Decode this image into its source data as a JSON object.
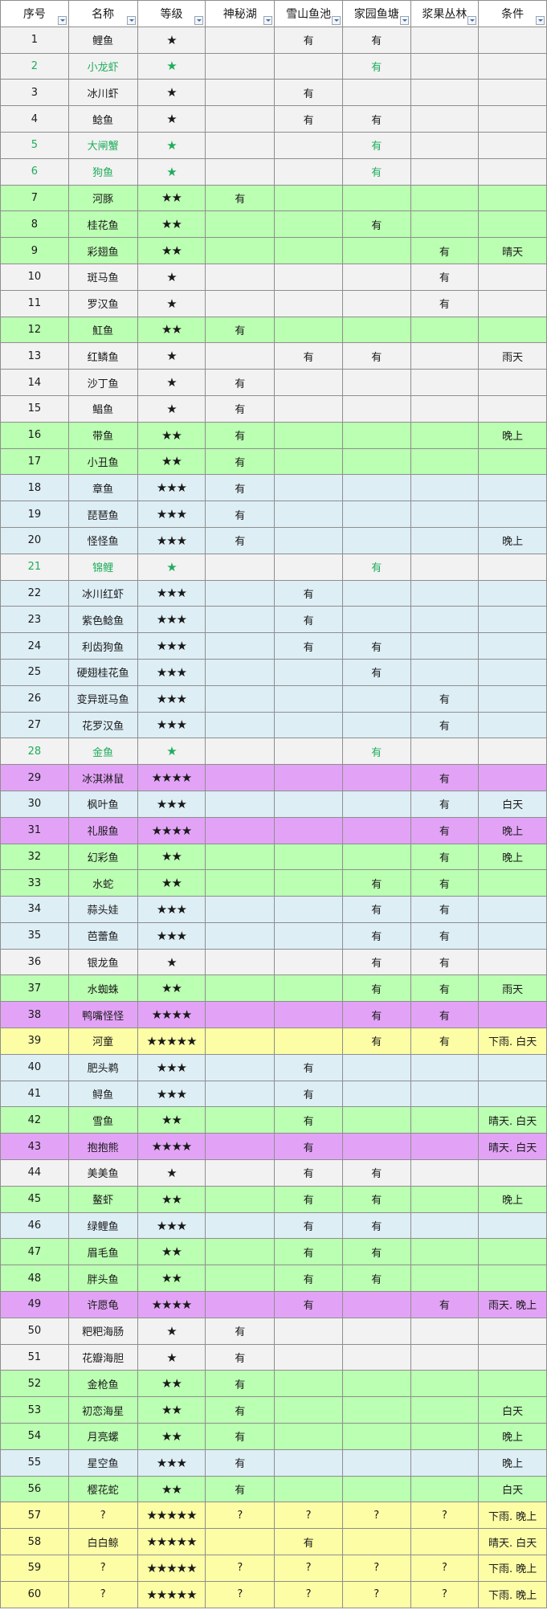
{
  "headers": [
    "序号",
    "名称",
    "等级",
    "神秘湖",
    "雪山鱼池",
    "家园鱼塘",
    "浆果丛林",
    "条件"
  ],
  "rows": [
    {
      "no": "1",
      "name": "鲤鱼",
      "grade": "★",
      "lake": "",
      "snow": "有",
      "home": "有",
      "berry": "",
      "cond": "",
      "color": "grey",
      "special": false
    },
    {
      "no": "2",
      "name": "小龙虾",
      "grade": "★",
      "lake": "",
      "snow": "",
      "home": "有",
      "berry": "",
      "cond": "",
      "color": "grey",
      "special": true
    },
    {
      "no": "3",
      "name": "冰川虾",
      "grade": "★",
      "lake": "",
      "snow": "有",
      "home": "",
      "berry": "",
      "cond": "",
      "color": "grey",
      "special": false
    },
    {
      "no": "4",
      "name": "鲶鱼",
      "grade": "★",
      "lake": "",
      "snow": "有",
      "home": "有",
      "berry": "",
      "cond": "",
      "color": "grey",
      "special": false
    },
    {
      "no": "5",
      "name": "大闸蟹",
      "grade": "★",
      "lake": "",
      "snow": "",
      "home": "有",
      "berry": "",
      "cond": "",
      "color": "grey",
      "special": true
    },
    {
      "no": "6",
      "name": "狗鱼",
      "grade": "★",
      "lake": "",
      "snow": "",
      "home": "有",
      "berry": "",
      "cond": "",
      "color": "grey",
      "special": true
    },
    {
      "no": "7",
      "name": "河豚",
      "grade": "★★",
      "lake": "有",
      "snow": "",
      "home": "",
      "berry": "",
      "cond": "",
      "color": "green",
      "special": false
    },
    {
      "no": "8",
      "name": "桂花鱼",
      "grade": "★★",
      "lake": "",
      "snow": "",
      "home": "有",
      "berry": "",
      "cond": "",
      "color": "green",
      "special": false
    },
    {
      "no": "9",
      "name": "彩翅鱼",
      "grade": "★★",
      "lake": "",
      "snow": "",
      "home": "",
      "berry": "有",
      "cond": "晴天",
      "color": "green",
      "special": false
    },
    {
      "no": "10",
      "name": "斑马鱼",
      "grade": "★",
      "lake": "",
      "snow": "",
      "home": "",
      "berry": "有",
      "cond": "",
      "color": "grey",
      "special": false
    },
    {
      "no": "11",
      "name": "罗汉鱼",
      "grade": "★",
      "lake": "",
      "snow": "",
      "home": "",
      "berry": "有",
      "cond": "",
      "color": "grey",
      "special": false
    },
    {
      "no": "12",
      "name": "魟鱼",
      "grade": "★★",
      "lake": "有",
      "snow": "",
      "home": "",
      "berry": "",
      "cond": "",
      "color": "green",
      "special": false
    },
    {
      "no": "13",
      "name": "红鳞鱼",
      "grade": "★",
      "lake": "",
      "snow": "有",
      "home": "有",
      "berry": "",
      "cond": "雨天",
      "color": "grey",
      "special": false
    },
    {
      "no": "14",
      "name": "沙丁鱼",
      "grade": "★",
      "lake": "有",
      "snow": "",
      "home": "",
      "berry": "",
      "cond": "",
      "color": "grey",
      "special": false
    },
    {
      "no": "15",
      "name": "鲳鱼",
      "grade": "★",
      "lake": "有",
      "snow": "",
      "home": "",
      "berry": "",
      "cond": "",
      "color": "grey",
      "special": false
    },
    {
      "no": "16",
      "name": "带鱼",
      "grade": "★★",
      "lake": "有",
      "snow": "",
      "home": "",
      "berry": "",
      "cond": "晚上",
      "color": "green",
      "special": false
    },
    {
      "no": "17",
      "name": "小丑鱼",
      "grade": "★★",
      "lake": "有",
      "snow": "",
      "home": "",
      "berry": "",
      "cond": "",
      "color": "green",
      "special": false
    },
    {
      "no": "18",
      "name": "章鱼",
      "grade": "★★★",
      "lake": "有",
      "snow": "",
      "home": "",
      "berry": "",
      "cond": "",
      "color": "blue",
      "special": false
    },
    {
      "no": "19",
      "name": "琵琶鱼",
      "grade": "★★★",
      "lake": "有",
      "snow": "",
      "home": "",
      "berry": "",
      "cond": "",
      "color": "blue",
      "special": false
    },
    {
      "no": "20",
      "name": "怪怪鱼",
      "grade": "★★★",
      "lake": "有",
      "snow": "",
      "home": "",
      "berry": "",
      "cond": "晚上",
      "color": "blue",
      "special": false
    },
    {
      "no": "21",
      "name": "锦鲤",
      "grade": "★",
      "lake": "",
      "snow": "",
      "home": "有",
      "berry": "",
      "cond": "",
      "color": "grey",
      "special": true
    },
    {
      "no": "22",
      "name": "冰川红虾",
      "grade": "★★★",
      "lake": "",
      "snow": "有",
      "home": "",
      "berry": "",
      "cond": "",
      "color": "blue",
      "special": false
    },
    {
      "no": "23",
      "name": "紫色鲶鱼",
      "grade": "★★★",
      "lake": "",
      "snow": "有",
      "home": "",
      "berry": "",
      "cond": "",
      "color": "blue",
      "special": false
    },
    {
      "no": "24",
      "name": "利齿狗鱼",
      "grade": "★★★",
      "lake": "",
      "snow": "有",
      "home": "有",
      "berry": "",
      "cond": "",
      "color": "blue",
      "special": false
    },
    {
      "no": "25",
      "name": "硬翅桂花鱼",
      "grade": "★★★",
      "lake": "",
      "snow": "",
      "home": "有",
      "berry": "",
      "cond": "",
      "color": "blue",
      "special": false
    },
    {
      "no": "26",
      "name": "变异斑马鱼",
      "grade": "★★★",
      "lake": "",
      "snow": "",
      "home": "",
      "berry": "有",
      "cond": "",
      "color": "blue",
      "special": false
    },
    {
      "no": "27",
      "name": "花罗汉鱼",
      "grade": "★★★",
      "lake": "",
      "snow": "",
      "home": "",
      "berry": "有",
      "cond": "",
      "color": "blue",
      "special": false
    },
    {
      "no": "28",
      "name": "金鱼",
      "grade": "★",
      "lake": "",
      "snow": "",
      "home": "有",
      "berry": "",
      "cond": "",
      "color": "grey",
      "special": true
    },
    {
      "no": "29",
      "name": "冰淇淋鼠",
      "grade": "★★★★",
      "lake": "",
      "snow": "",
      "home": "",
      "berry": "有",
      "cond": "",
      "color": "purple",
      "special": false
    },
    {
      "no": "30",
      "name": "枫叶鱼",
      "grade": "★★★",
      "lake": "",
      "snow": "",
      "home": "",
      "berry": "有",
      "cond": "白天",
      "color": "blue",
      "special": false
    },
    {
      "no": "31",
      "name": "礼服鱼",
      "grade": "★★★★",
      "lake": "",
      "snow": "",
      "home": "",
      "berry": "有",
      "cond": "晚上",
      "color": "purple",
      "special": false
    },
    {
      "no": "32",
      "name": "幻彩鱼",
      "grade": "★★",
      "lake": "",
      "snow": "",
      "home": "",
      "berry": "有",
      "cond": "晚上",
      "color": "green",
      "special": false
    },
    {
      "no": "33",
      "name": "水蛇",
      "grade": "★★",
      "lake": "",
      "snow": "",
      "home": "有",
      "berry": "有",
      "cond": "",
      "color": "green",
      "special": false
    },
    {
      "no": "34",
      "name": "蒜头娃",
      "grade": "★★★",
      "lake": "",
      "snow": "",
      "home": "有",
      "berry": "有",
      "cond": "",
      "color": "blue",
      "special": false
    },
    {
      "no": "35",
      "name": "芭蕾鱼",
      "grade": "★★★",
      "lake": "",
      "snow": "",
      "home": "有",
      "berry": "有",
      "cond": "",
      "color": "blue",
      "special": false
    },
    {
      "no": "36",
      "name": "银龙鱼",
      "grade": "★",
      "lake": "",
      "snow": "",
      "home": "有",
      "berry": "有",
      "cond": "",
      "color": "grey",
      "special": false
    },
    {
      "no": "37",
      "name": "水蜘蛛",
      "grade": "★★",
      "lake": "",
      "snow": "",
      "home": "有",
      "berry": "有",
      "cond": "雨天",
      "color": "green",
      "special": false
    },
    {
      "no": "38",
      "name": "鸭嘴怪怪",
      "grade": "★★★★",
      "lake": "",
      "snow": "",
      "home": "有",
      "berry": "有",
      "cond": "",
      "color": "purple",
      "special": false
    },
    {
      "no": "39",
      "name": "河童",
      "grade": "★★★★★",
      "lake": "",
      "snow": "",
      "home": "有",
      "berry": "有",
      "cond": "下雨. 白天",
      "color": "yellow",
      "special": false
    },
    {
      "no": "40",
      "name": "肥头鹈",
      "grade": "★★★",
      "lake": "",
      "snow": "有",
      "home": "",
      "berry": "",
      "cond": "",
      "color": "blue",
      "special": false
    },
    {
      "no": "41",
      "name": "鲟鱼",
      "grade": "★★★",
      "lake": "",
      "snow": "有",
      "home": "",
      "berry": "",
      "cond": "",
      "color": "blue",
      "special": false
    },
    {
      "no": "42",
      "name": "雪鱼",
      "grade": "★★",
      "lake": "",
      "snow": "有",
      "home": "",
      "berry": "",
      "cond": "晴天. 白天",
      "color": "green",
      "special": false
    },
    {
      "no": "43",
      "name": "抱抱熊",
      "grade": "★★★★",
      "lake": "",
      "snow": "有",
      "home": "",
      "berry": "",
      "cond": "晴天. 白天",
      "color": "purple",
      "special": false
    },
    {
      "no": "44",
      "name": "美美鱼",
      "grade": "★",
      "lake": "",
      "snow": "有",
      "home": "有",
      "berry": "",
      "cond": "",
      "color": "grey",
      "special": false
    },
    {
      "no": "45",
      "name": "鳌虾",
      "grade": "★★",
      "lake": "",
      "snow": "有",
      "home": "有",
      "berry": "",
      "cond": "晚上",
      "color": "green",
      "special": false
    },
    {
      "no": "46",
      "name": "绿鲤鱼",
      "grade": "★★★",
      "lake": "",
      "snow": "有",
      "home": "有",
      "berry": "",
      "cond": "",
      "color": "blue",
      "special": false
    },
    {
      "no": "47",
      "name": "眉毛鱼",
      "grade": "★★",
      "lake": "",
      "snow": "有",
      "home": "有",
      "berry": "",
      "cond": "",
      "color": "green",
      "special": false
    },
    {
      "no": "48",
      "name": "胖头鱼",
      "grade": "★★",
      "lake": "",
      "snow": "有",
      "home": "有",
      "berry": "",
      "cond": "",
      "color": "green",
      "special": false
    },
    {
      "no": "49",
      "name": "许愿龟",
      "grade": "★★★★",
      "lake": "",
      "snow": "有",
      "home": "",
      "berry": "有",
      "cond": "雨天. 晚上",
      "color": "purple",
      "special": false
    },
    {
      "no": "50",
      "name": "粑粑海肠",
      "grade": "★",
      "lake": "有",
      "snow": "",
      "home": "",
      "berry": "",
      "cond": "",
      "color": "grey",
      "special": false
    },
    {
      "no": "51",
      "name": "花瓣海胆",
      "grade": "★",
      "lake": "有",
      "snow": "",
      "home": "",
      "berry": "",
      "cond": "",
      "color": "grey",
      "special": false
    },
    {
      "no": "52",
      "name": "金枪鱼",
      "grade": "★★",
      "lake": "有",
      "snow": "",
      "home": "",
      "berry": "",
      "cond": "",
      "color": "green",
      "special": false
    },
    {
      "no": "53",
      "name": "初恋海星",
      "grade": "★★",
      "lake": "有",
      "snow": "",
      "home": "",
      "berry": "",
      "cond": "白天",
      "color": "green",
      "special": false
    },
    {
      "no": "54",
      "name": "月亮螺",
      "grade": "★★",
      "lake": "有",
      "snow": "",
      "home": "",
      "berry": "",
      "cond": "晚上",
      "color": "green",
      "special": false
    },
    {
      "no": "55",
      "name": "星空鱼",
      "grade": "★★★",
      "lake": "有",
      "snow": "",
      "home": "",
      "berry": "",
      "cond": "晚上",
      "color": "blue",
      "special": false
    },
    {
      "no": "56",
      "name": "樱花蛇",
      "grade": "★★",
      "lake": "有",
      "snow": "",
      "home": "",
      "berry": "",
      "cond": "白天",
      "color": "green",
      "special": false
    },
    {
      "no": "57",
      "name": "?",
      "grade": "★★★★★",
      "lake": "?",
      "snow": "?",
      "home": "?",
      "berry": "?",
      "cond": "下雨. 晚上",
      "color": "yellow",
      "special": false
    },
    {
      "no": "58",
      "name": "白白鲸",
      "grade": "★★★★★",
      "lake": "",
      "snow": "有",
      "home": "",
      "berry": "",
      "cond": "晴天. 白天",
      "color": "yellow",
      "special": false
    },
    {
      "no": "59",
      "name": "?",
      "grade": "★★★★★",
      "lake": "?",
      "snow": "?",
      "home": "?",
      "berry": "?",
      "cond": "下雨. 晚上",
      "color": "yellow",
      "special": false
    },
    {
      "no": "60",
      "name": "?",
      "grade": "★★★★★",
      "lake": "?",
      "snow": "?",
      "home": "?",
      "berry": "?",
      "cond": "下雨. 晚上",
      "color": "yellow",
      "special": false
    }
  ]
}
